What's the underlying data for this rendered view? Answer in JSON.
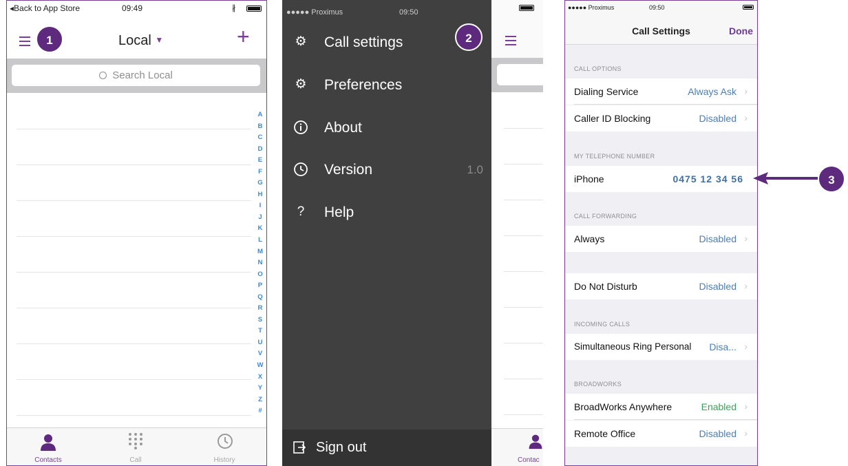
{
  "screen1": {
    "status": {
      "back": "◂Back to App Store",
      "time": "09:49"
    },
    "badge": "1",
    "title": "Local",
    "search_placeholder": "Search Local",
    "index_letters": [
      "A",
      "B",
      "C",
      "D",
      "E",
      "F",
      "G",
      "H",
      "I",
      "J",
      "K",
      "L",
      "M",
      "N",
      "O",
      "P",
      "Q",
      "R",
      "S",
      "T",
      "U",
      "V",
      "W",
      "X",
      "Y",
      "Z",
      "#"
    ],
    "tabs": [
      {
        "label": "Contacts",
        "icon": "person-icon"
      },
      {
        "label": "Call",
        "icon": "keypad-icon"
      },
      {
        "label": "History",
        "icon": "history-icon"
      }
    ]
  },
  "screen2": {
    "status": {
      "carrier": "●●●●● Proximus",
      "time": "09:50"
    },
    "badge": "2",
    "menu": [
      {
        "label": "Call settings",
        "icon": "gear-icon"
      },
      {
        "label": "Preferences",
        "icon": "preferences-icon"
      },
      {
        "label": "About",
        "icon": "info-icon"
      },
      {
        "label": "Version",
        "icon": "clock-icon",
        "value": "1.0"
      },
      {
        "label": "Help",
        "icon": "help-icon"
      }
    ],
    "sign_out": "Sign out",
    "behind_tab": "Contac"
  },
  "screen3": {
    "status": {
      "carrier": "●●●●● Proximus",
      "time": "09:50"
    },
    "title": "Call Settings",
    "done": "Done",
    "sections": {
      "call_options": "CALL OPTIONS",
      "my_number": "MY TELEPHONE NUMBER",
      "call_forwarding": "CALL FORWARDING",
      "incoming": "INCOMING CALLS",
      "broadworks": "BROADWORKS"
    },
    "rows": {
      "dialing": {
        "label": "Dialing Service",
        "value": "Always Ask"
      },
      "callerid": {
        "label": "Caller ID Blocking",
        "value": "Disabled"
      },
      "iphone": {
        "label": "iPhone",
        "value": "0475 12 34 56"
      },
      "always": {
        "label": "Always",
        "value": "Disabled"
      },
      "dnd": {
        "label": "Do Not Disturb",
        "value": "Disabled"
      },
      "simring": {
        "label": "Simultaneous Ring Personal",
        "value": "Disa..."
      },
      "bwanywhere": {
        "label": "BroadWorks Anywhere",
        "value": "Enabled"
      },
      "remote": {
        "label": "Remote Office",
        "value": "Disabled"
      }
    },
    "badge": "3"
  },
  "colors": {
    "accent": "#5e2a7e",
    "link": "#4a7eb8",
    "enabled": "#3aa35a",
    "drawer": "#404040"
  }
}
